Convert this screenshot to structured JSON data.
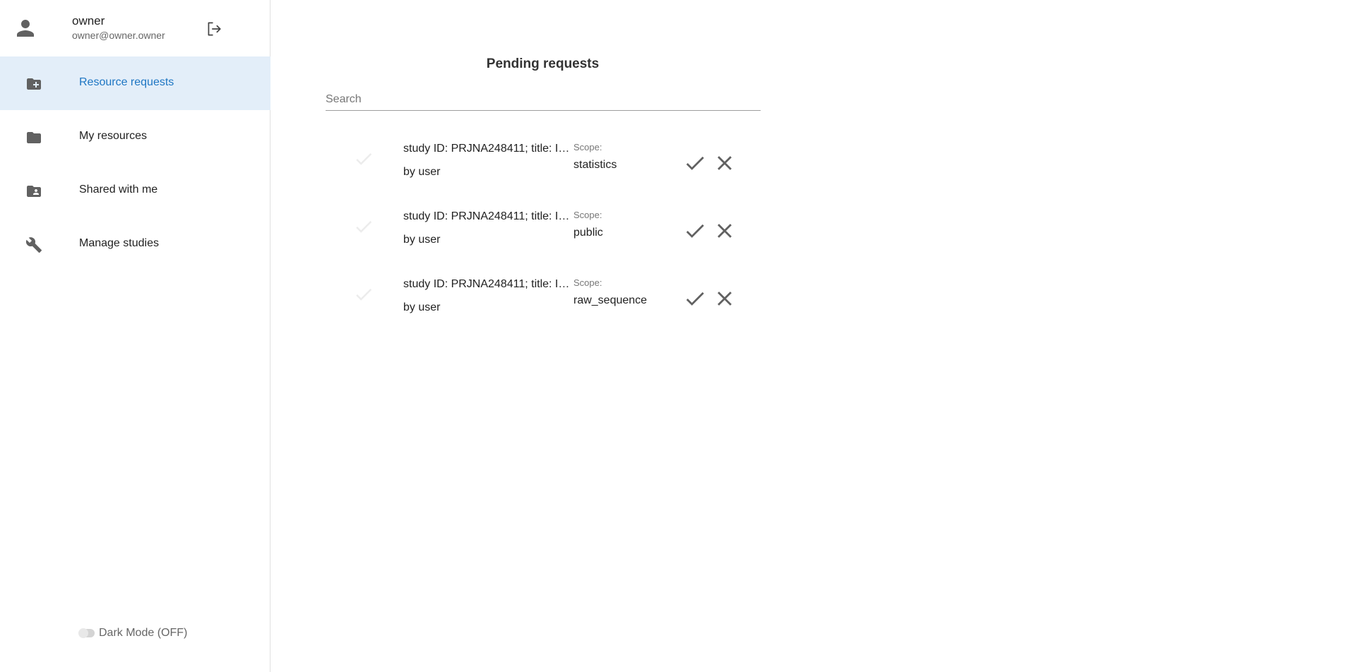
{
  "user": {
    "name": "owner",
    "email": "owner@owner.owner"
  },
  "nav": {
    "items": [
      {
        "label": "Resource requests",
        "icon": "folder-plus-icon",
        "active": true
      },
      {
        "label": "My resources",
        "icon": "folder-icon",
        "active": false
      },
      {
        "label": "Shared with me",
        "icon": "folder-shared-icon",
        "active": false
      },
      {
        "label": "Manage studies",
        "icon": "wrench-icon",
        "active": false
      }
    ]
  },
  "dark_mode": {
    "label": "Dark Mode (OFF)"
  },
  "main": {
    "title": "Pending requests",
    "search": {
      "placeholder": "Search",
      "value": ""
    },
    "requests": [
      {
        "title": "study ID: PRJNA248411; title: I…",
        "subtitle": "by user",
        "scope_label": "Scope:",
        "scope": "statistics"
      },
      {
        "title": "study ID: PRJNA248411; title: I…",
        "subtitle": "by user",
        "scope_label": "Scope:",
        "scope": "public"
      },
      {
        "title": "study ID: PRJNA248411; title: I…",
        "subtitle": "by user",
        "scope_label": "Scope:",
        "scope": "raw_sequence"
      }
    ]
  },
  "colors": {
    "accent": "#1e76c3",
    "active_bg": "#e3eef9",
    "icon_gray": "#616161"
  }
}
